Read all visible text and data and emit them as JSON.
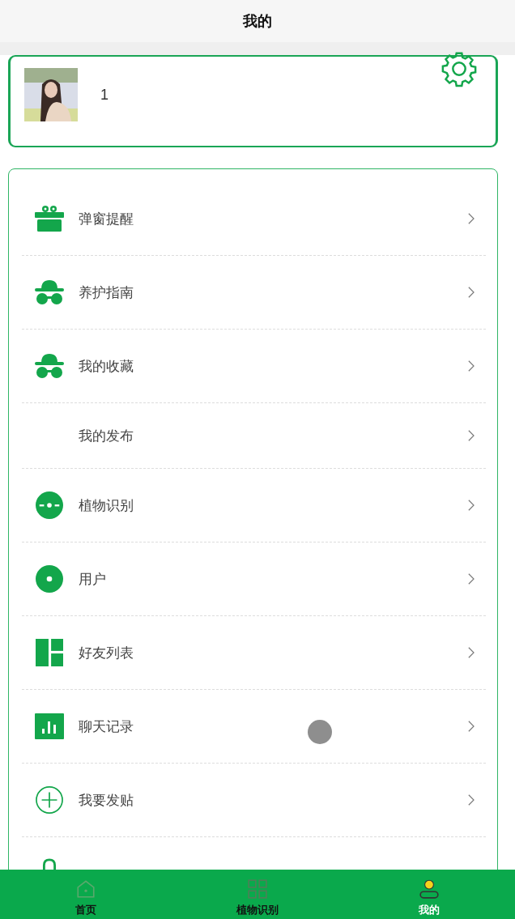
{
  "header": {
    "title": "我的"
  },
  "profile": {
    "name": "1"
  },
  "menu": [
    {
      "label": "弹窗提醒"
    },
    {
      "label": "养护指南"
    },
    {
      "label": "我的收藏"
    },
    {
      "label": "我的发布"
    },
    {
      "label": "植物识别"
    },
    {
      "label": "用户"
    },
    {
      "label": "好友列表"
    },
    {
      "label": "聊天记录"
    },
    {
      "label": "我要发贴"
    }
  ],
  "tabbar": [
    {
      "label": "首页",
      "selected": false
    },
    {
      "label": "植物识别",
      "selected": false
    },
    {
      "label": "我的",
      "selected": true
    }
  ]
}
